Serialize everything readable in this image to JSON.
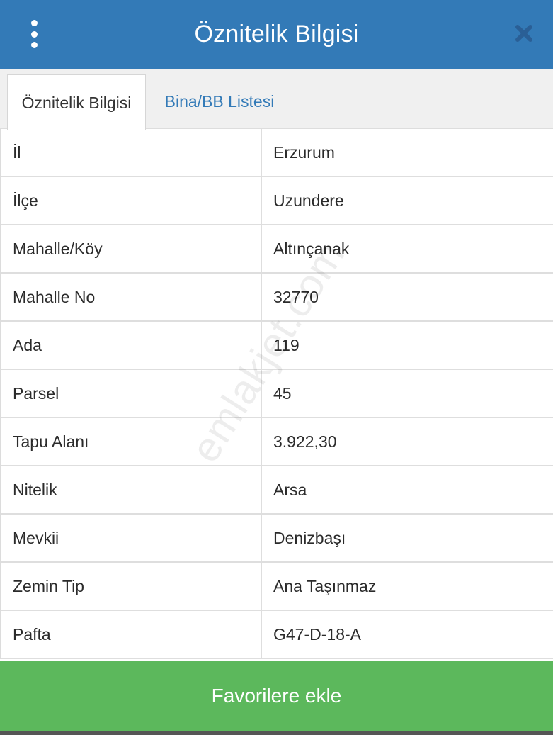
{
  "header": {
    "title": "Öznitelik Bilgisi",
    "menu_icon": "vertical-ellipsis",
    "close_icon": "close-x"
  },
  "tabs": [
    {
      "label": "Öznitelik Bilgisi",
      "active": true
    },
    {
      "label": "Bina/BB Listesi",
      "active": false
    }
  ],
  "attributes": [
    {
      "label": "İl",
      "value": "Erzurum"
    },
    {
      "label": "İlçe",
      "value": "Uzundere"
    },
    {
      "label": "Mahalle/Köy",
      "value": "Altınçanak"
    },
    {
      "label": "Mahalle No",
      "value": "32770"
    },
    {
      "label": "Ada",
      "value": "119"
    },
    {
      "label": "Parsel",
      "value": "45"
    },
    {
      "label": "Tapu Alanı",
      "value": "3.922,30"
    },
    {
      "label": "Nitelik",
      "value": "Arsa"
    },
    {
      "label": "Mevkii",
      "value": "Denizbaşı"
    },
    {
      "label": "Zemin Tip",
      "value": "Ana Taşınmaz"
    },
    {
      "label": "Pafta",
      "value": "G47-D-18-A"
    }
  ],
  "watermark": "emlakjet.com",
  "footer": {
    "favorite_label": "Favorilere ekle"
  },
  "colors": {
    "header": "#337ab7",
    "favorite_button": "#5cb85c",
    "tab_link": "#337ab7"
  }
}
